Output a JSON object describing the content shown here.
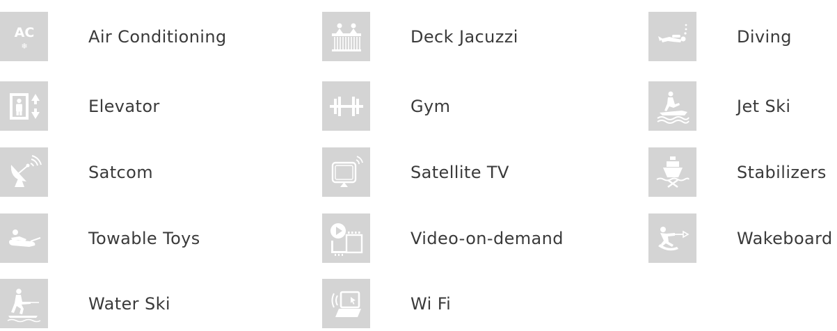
{
  "amenities": {
    "air_conditioning": {
      "label": "Air Conditioning",
      "icon": "air-conditioning-icon",
      "icon_text": "AC",
      "icon_glyph": "❄"
    },
    "deck_jacuzzi": {
      "label": "Deck Jacuzzi",
      "icon": "jacuzzi-icon"
    },
    "diving": {
      "label": "Diving",
      "icon": "diver-icon"
    },
    "elevator": {
      "label": "Elevator",
      "icon": "elevator-icon"
    },
    "gym": {
      "label": "Gym",
      "icon": "dumbbell-icon"
    },
    "jet_ski": {
      "label": "Jet Ski",
      "icon": "jet-ski-icon"
    },
    "satcom": {
      "label": "Satcom",
      "icon": "satellite-dish-icon"
    },
    "satellite_tv": {
      "label": "Satellite TV",
      "icon": "tv-icon"
    },
    "stabilizers": {
      "label": "Stabilizers",
      "icon": "yacht-stabilizer-icon"
    },
    "towable_toys": {
      "label": "Towable Toys",
      "icon": "towable-tube-icon"
    },
    "video_on_demand": {
      "label": "Video-on-demand",
      "icon": "video-film-icon"
    },
    "wakeboard": {
      "label": "Wakeboard",
      "icon": "wakeboarder-icon"
    },
    "water_ski": {
      "label": "Water Ski",
      "icon": "water-skier-icon"
    },
    "wifi": {
      "label": "Wi Fi",
      "icon": "wifi-laptop-icon"
    }
  },
  "colors": {
    "tile_bg": "#d4d4d4",
    "icon": "#ffffff",
    "text": "#3a3a3a"
  }
}
